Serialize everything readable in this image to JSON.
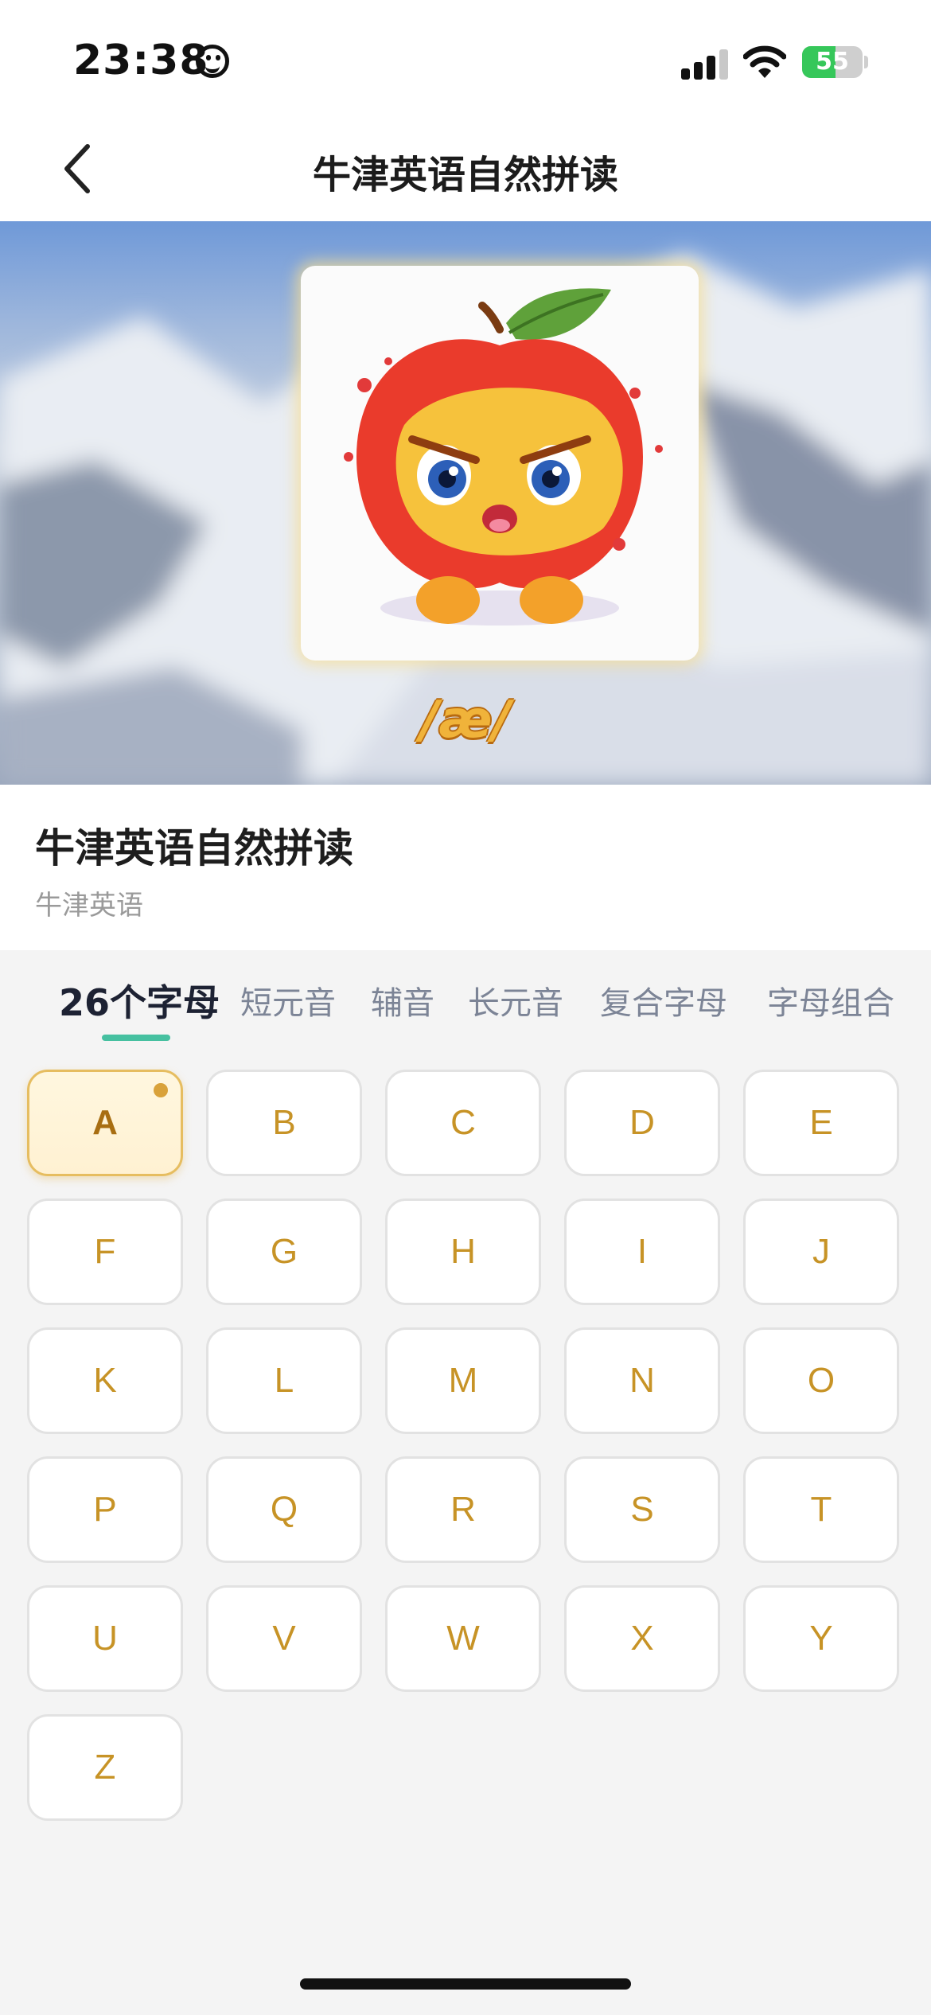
{
  "status_bar": {
    "time": "23:38",
    "battery_text": "55",
    "battery_level": 0.55,
    "icons": [
      "smiley-face-icon",
      "cellular-signal-icon",
      "wifi-icon",
      "battery-charging-icon"
    ]
  },
  "nav": {
    "back_icon": "chevron-left-icon",
    "title": "牛津英语自然拼读"
  },
  "hero": {
    "image": "cartoon-apple-illustration",
    "phonetic": "/æ/"
  },
  "course": {
    "title": "牛津英语自然拼读",
    "subtitle": "牛津英语"
  },
  "tabs": [
    {
      "label": "26个字母",
      "active": true
    },
    {
      "label": "短元音",
      "active": false
    },
    {
      "label": "辅音",
      "active": false
    },
    {
      "label": "长元音",
      "active": false
    },
    {
      "label": "复合字母",
      "active": false
    },
    {
      "label": "字母组合",
      "active": false
    }
  ],
  "letters": [
    "A",
    "B",
    "C",
    "D",
    "E",
    "F",
    "G",
    "H",
    "I",
    "J",
    "K",
    "L",
    "M",
    "N",
    "O",
    "P",
    "Q",
    "R",
    "S",
    "T",
    "U",
    "V",
    "W",
    "X",
    "Y",
    "Z"
  ],
  "selected_letter": "A",
  "colors": {
    "accent_gold": "#c79326",
    "tab_underline": "#46c0a0",
    "battery_green": "#36c75a"
  }
}
